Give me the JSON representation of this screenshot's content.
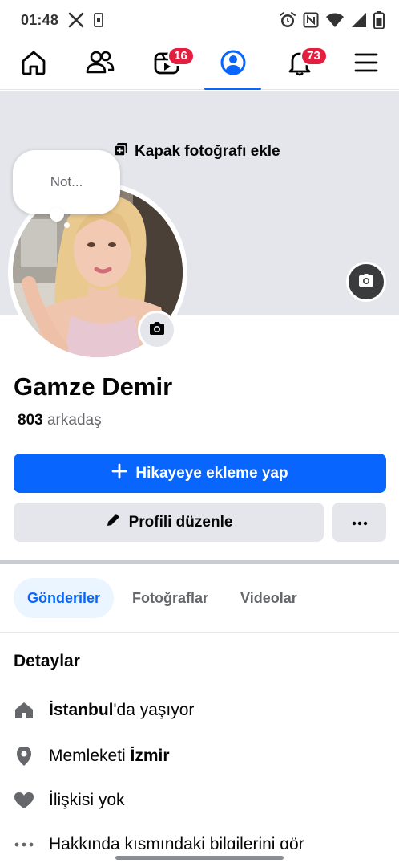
{
  "status_bar": {
    "time": "01:48",
    "left_icons": [
      "x-logo-icon",
      "sim-card-icon"
    ],
    "right_icons": [
      "alarm-icon",
      "nfc-icon",
      "wifi-icon",
      "signal-icon",
      "battery-icon"
    ]
  },
  "top_nav": {
    "items": [
      {
        "name": "home",
        "icon": "home-icon",
        "active": false,
        "badge": ""
      },
      {
        "name": "friends",
        "icon": "friends-icon",
        "active": false,
        "badge": ""
      },
      {
        "name": "video",
        "icon": "video-icon",
        "active": false,
        "badge": "16"
      },
      {
        "name": "profile",
        "icon": "profile-icon",
        "active": true,
        "badge": ""
      },
      {
        "name": "notifications",
        "icon": "bell-icon",
        "active": false,
        "badge": "73"
      },
      {
        "name": "menu",
        "icon": "menu-icon",
        "active": false,
        "badge": ""
      }
    ]
  },
  "cover": {
    "add_label": "Kapak fotoğrafı ekle"
  },
  "note": {
    "placeholder": "Not..."
  },
  "profile": {
    "name": "Gamze Demir",
    "friends_count": "803",
    "friends_label": "arkadaş"
  },
  "actions": {
    "story_label": "Hikayeye ekleme yap",
    "edit_label": "Profili düzenle"
  },
  "tabs": [
    {
      "label": "Gönderiler",
      "active": true
    },
    {
      "label": "Fotoğraflar",
      "active": false
    },
    {
      "label": "Videolar",
      "active": false
    }
  ],
  "details": {
    "title": "Detaylar",
    "lives_city": "İstanbul",
    "lives_suffix": "'da yaşıyor",
    "hometown_prefix": "Memleketi ",
    "hometown_city": "İzmir",
    "relationship": "İlişkisi yok",
    "about_link": "Hakkında kısmındaki bilgilerini gör"
  },
  "colors": {
    "accent": "#0866ff",
    "badge": "#e41e3f",
    "cover_bg": "#e4e6eb",
    "secondary_button": "#e4e6eb",
    "secondary_text": "#65676b"
  }
}
